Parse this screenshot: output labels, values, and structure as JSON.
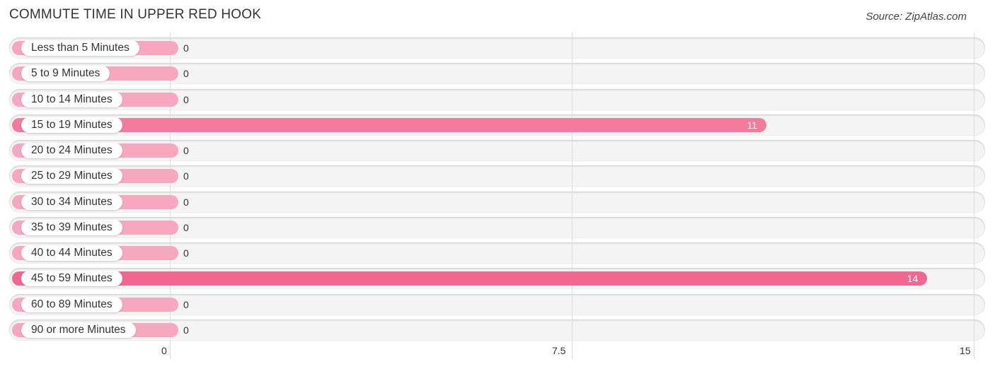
{
  "chart_data": {
    "type": "bar",
    "orientation": "horizontal",
    "title": "COMMUTE TIME IN UPPER RED HOOK",
    "source": "Source: ZipAtlas.com",
    "categories": [
      "Less than 5 Minutes",
      "5 to 9 Minutes",
      "10 to 14 Minutes",
      "15 to 19 Minutes",
      "20 to 24 Minutes",
      "25 to 29 Minutes",
      "30 to 34 Minutes",
      "35 to 39 Minutes",
      "40 to 44 Minutes",
      "45 to 59 Minutes",
      "60 to 89 Minutes",
      "90 or more Minutes"
    ],
    "values": [
      0,
      0,
      0,
      11,
      0,
      0,
      0,
      0,
      0,
      14,
      0,
      0
    ],
    "xlim": [
      0,
      15
    ],
    "ticks": [
      {
        "value": 0,
        "label": "0"
      },
      {
        "value": 7.5,
        "label": "7.5"
      },
      {
        "value": 15,
        "label": "15"
      }
    ],
    "grid": true,
    "colors": {
      "zero_bar": "#f7a8c0",
      "bar_mid": "#f47a9e",
      "bar_max": "#f06890"
    }
  }
}
